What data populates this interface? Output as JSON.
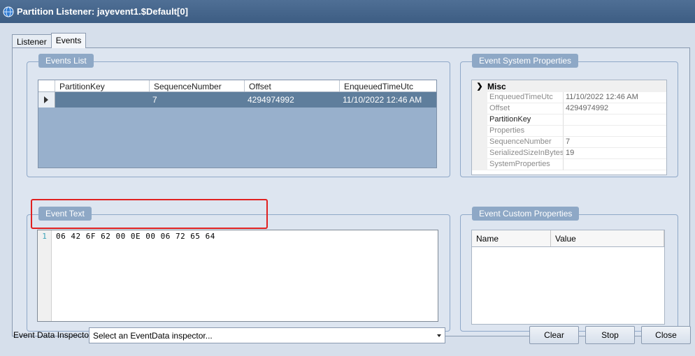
{
  "window": {
    "title": "Partition Listener: jayevent1.$Default[0]"
  },
  "tabs": [
    {
      "label": "Listener"
    },
    {
      "label": "Events"
    }
  ],
  "events_list": {
    "title": "Events List",
    "columns": [
      "PartitionKey",
      "SequenceNumber",
      "Offset",
      "EnqueuedTimeUtc"
    ],
    "rows": [
      {
        "partition_key": "",
        "sequence_number": "7",
        "offset": "4294974992",
        "enqueued_time_utc": "11/10/2022 12:46 AM"
      }
    ]
  },
  "system_props": {
    "title": "Event System Properties",
    "category": "Misc",
    "rows": [
      {
        "name": "EnqueuedTimeUtc",
        "value": "11/10/2022 12:46 AM"
      },
      {
        "name": "Offset",
        "value": "4294974992"
      },
      {
        "name": "PartitionKey",
        "value": ""
      },
      {
        "name": "Properties",
        "value": ""
      },
      {
        "name": "SequenceNumber",
        "value": "7"
      },
      {
        "name": "SerializedSizeInBytes",
        "value": "19"
      },
      {
        "name": "SystemProperties",
        "value": ""
      }
    ]
  },
  "event_text": {
    "title": "Event Text",
    "line_number": "1",
    "content": "06 42 6F 62 00 0E 00 06 72 65 64"
  },
  "custom_props": {
    "title": "Event Custom Properties",
    "columns": [
      "Name",
      "Value"
    ]
  },
  "bottom": {
    "inspector_label": "Event Data Inspector:",
    "inspector_placeholder": "Select an EventData inspector...",
    "clear_label": "Clear",
    "stop_label": "Stop",
    "close_label": "Close"
  },
  "colors": {
    "title_bar": "#3d5d83",
    "group_title": "#8ea8c6",
    "selected_row": "#5f7e9c",
    "highlight_box": "#e02020"
  }
}
